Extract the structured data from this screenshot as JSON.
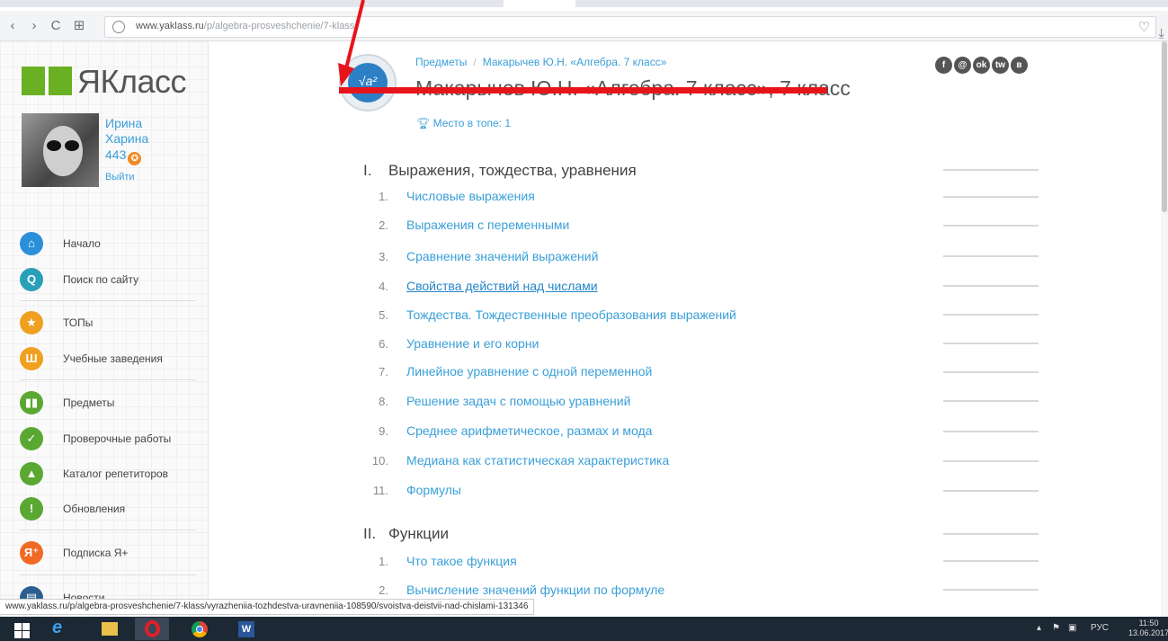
{
  "browser": {
    "back": "‹",
    "forward": "›",
    "reload": "C",
    "apps": "⊞",
    "url_domain": "www.yaklass.ru",
    "url_path": "/p/algebra-prosveshchenie/7-klass",
    "status_url": "www.yaklass.ru/p/algebra-prosveshchenie/7-klass/vyrazheniia-tozhdestva-uravneniia-108590/svoistva-deistvii-nad-chislami-131346"
  },
  "logo": {
    "text": "ЯКласс"
  },
  "user": {
    "first_name": "Ирина",
    "last_name": "Харина",
    "points": "443",
    "logout": "Выйти"
  },
  "menu": {
    "home": "Начало",
    "search": "Поиск по сайту",
    "tops": "ТОПы",
    "schools": "Учебные заведения",
    "subjects": "Предметы",
    "tests": "Проверочные работы",
    "tutors": "Каталог репетиторов",
    "updates": "Обновления",
    "subscription": "Подписка Я+",
    "news": "Новости"
  },
  "menu_icons": {
    "home": "house-icon",
    "search": "magnifier-icon",
    "tops": "star-icon",
    "schools": "building-icon",
    "subjects": "book-icon",
    "tests": "checkmark-icon",
    "tutors": "graduation-cap-icon",
    "updates": "exclamation-icon",
    "subscription": "ya-plus-icon",
    "news": "news-icon"
  },
  "menu_colors": {
    "home": "#2a8fd8",
    "search": "#2a9fb8",
    "tops": "#f0a020",
    "schools": "#f0a020",
    "subjects": "#5aa832",
    "tests": "#5aa832",
    "tutors": "#5aa832",
    "updates": "#5aa832",
    "subscription": "#f06a24",
    "news": "#2a5f8f"
  },
  "breadcrumb": {
    "root": "Предметы",
    "current": "Макарычев Ю.Н. «Алгебра. 7 класс»"
  },
  "title": "Макарычев Ю.Н. «Алгебра. 7 класс», 7 класс",
  "top_place": "Место в топе: 1",
  "socials": [
    "f",
    "@",
    "ok",
    "tw",
    "в"
  ],
  "sections": [
    {
      "num": "I.",
      "title": "Выражения, тождества, уравнения",
      "topics": [
        {
          "n": "1.",
          "title": "Числовые выражения"
        },
        {
          "n": "2.",
          "title": "Выражения с переменными"
        },
        {
          "n": "3.",
          "title": "Сравнение значений выражений"
        },
        {
          "n": "4.",
          "title": "Свойства действий над числами"
        },
        {
          "n": "5.",
          "title": "Тождества. Тождественные преобразования выражений"
        },
        {
          "n": "6.",
          "title": "Уравнение и его корни"
        },
        {
          "n": "7.",
          "title": "Линейное уравнение с одной переменной"
        },
        {
          "n": "8.",
          "title": "Решение задач с помощью уравнений"
        },
        {
          "n": "9.",
          "title": "Среднее арифметическое, размах и мода"
        },
        {
          "n": "10.",
          "title": "Медиана как статистическая характеристика"
        },
        {
          "n": "11.",
          "title": "Формулы"
        }
      ]
    },
    {
      "num": "II.",
      "title": "Функции",
      "topics": [
        {
          "n": "1.",
          "title": "Что такое функция"
        },
        {
          "n": "2.",
          "title": "Вычисление значений функции по формуле"
        }
      ]
    }
  ],
  "taskbar": {
    "lang": "РУС",
    "time": "11:50",
    "date": "13.06.2017"
  }
}
